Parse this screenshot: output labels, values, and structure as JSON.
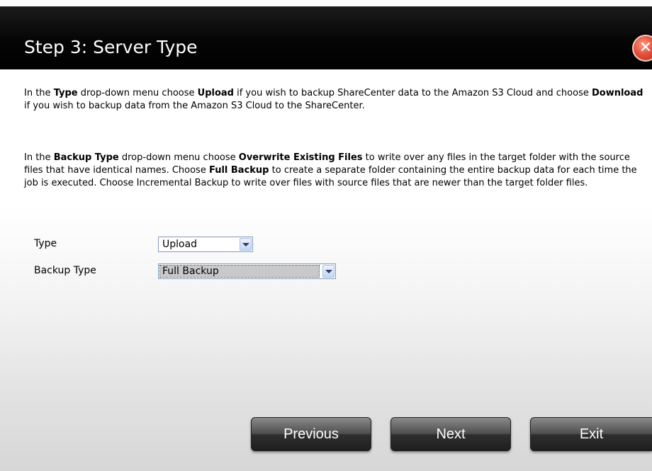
{
  "dialog": {
    "title": "Step 3: Server Type",
    "close_glyph": "✕"
  },
  "paragraph1": {
    "t1": "In the ",
    "b1": "Type",
    "t2": " drop-down menu choose ",
    "b2": "Upload",
    "t3": " if you wish to backup ShareCenter data to the Amazon S3 Cloud and choose ",
    "b3": "Download",
    "t4": " if you wish to backup data from the Amazon S3 Cloud to the ShareCenter."
  },
  "paragraph2": {
    "t1": "In the ",
    "b1": "Backup Type",
    "t2": " drop-down menu choose ",
    "b2": "Overwrite Existing Files",
    "t3": " to write over any files in the target folder with the source files that have identical names. Choose ",
    "b3": "Full Backup",
    "t4": " to create a separate folder containing the entire backup data for each time the job is executed. Choose Incremental Backup to write over files with source files that are newer than the target folder files."
  },
  "form": {
    "type_label": "Type",
    "type_value": "Upload",
    "backup_type_label": "Backup Type",
    "backup_type_value": "Full Backup"
  },
  "buttons": {
    "previous": "Previous",
    "next": "Next",
    "exit": "Exit"
  },
  "colors": {
    "titlebar": "#000000",
    "close_button": "#e2543f",
    "button": "#3a3a3a"
  },
  "icons": {
    "close": "close-icon",
    "dropdown": "chevron-down-icon"
  }
}
